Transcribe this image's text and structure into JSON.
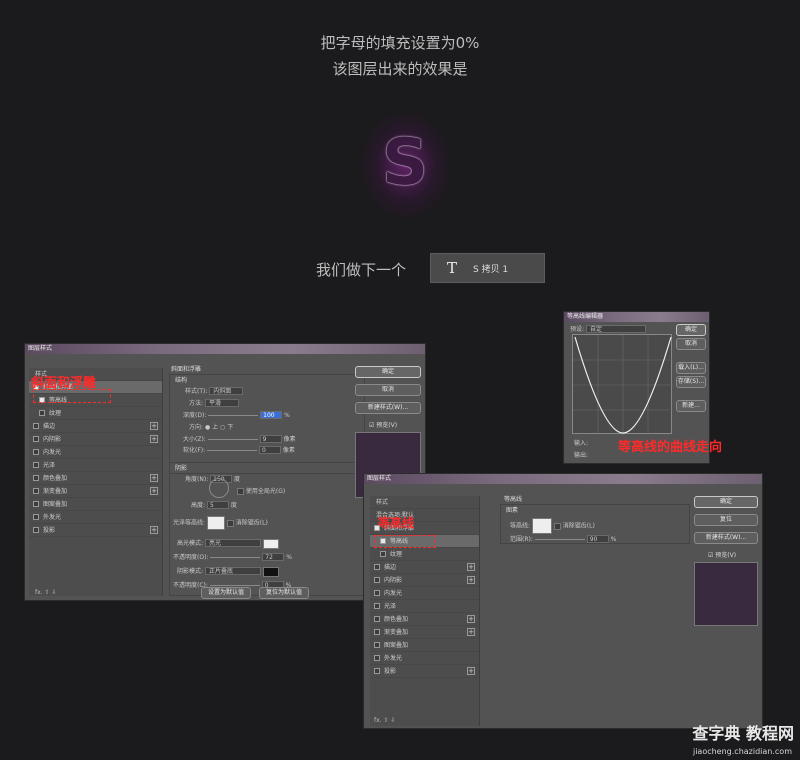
{
  "captions": [
    "把字母的填充设置为0%",
    "该图层出来的效果是"
  ],
  "preview_glyph": "S",
  "next_step": {
    "label": "我们做下一个",
    "layer_icon": "T",
    "layer_name": "S 拷贝 1"
  },
  "dialog1": {
    "title": "图层样式",
    "list": [
      {
        "label": "样式",
        "type": "head"
      },
      {
        "label": "斜面和浮雕",
        "checked": true,
        "selected": true
      },
      {
        "label": "等高线",
        "checked": true,
        "sub": true
      },
      {
        "label": "纹理",
        "checked": false,
        "sub": true
      },
      {
        "label": "描边",
        "plus": true
      },
      {
        "label": "内阴影",
        "plus": true
      },
      {
        "label": "内发光"
      },
      {
        "label": "光泽"
      },
      {
        "label": "颜色叠加",
        "plus": true
      },
      {
        "label": "渐变叠加",
        "plus": true
      },
      {
        "label": "图案叠加"
      },
      {
        "label": "外发光"
      },
      {
        "label": "投影",
        "plus": true
      }
    ],
    "footer": "fx. ⇧ ⇩",
    "section_title": "斜面和浮雕",
    "structure_title": "结构",
    "style_label": "样式(T):",
    "style_value": "内斜面",
    "method_label": "方法:",
    "method_value": "平滑",
    "depth_label": "深度(D):",
    "depth_value": "100",
    "depth_unit": "%",
    "direction_label": "方向:",
    "dir_up": "上",
    "dir_down": "下",
    "size_label": "大小(Z):",
    "size_value": "9",
    "size_unit": "像素",
    "soften_label": "软化(F):",
    "soften_value": "0",
    "soften_unit": "像素",
    "shading_title": "阴影",
    "angle_label": "角度(N):",
    "angle_value": "150",
    "angle_unit": "度",
    "global_light": "使用全局光(G)",
    "altitude_label": "高度:",
    "altitude_value": "5",
    "altitude_unit": "度",
    "gloss_label": "光泽等高线:",
    "antialias": "消除锯齿(L)",
    "highlight_label": "高光模式:",
    "highlight_value": "亮光",
    "opacity1_label": "不透明度(O):",
    "opacity1_value": "72",
    "opacity_unit": "%",
    "shadow_label": "阴影模式:",
    "shadow_value": "正片叠底",
    "opacity2_label": "不透明度(C):",
    "opacity2_value": "0",
    "default_btn": "设置为默认值",
    "reset_btn": "复位为默认值",
    "ok": "确定",
    "cancel": "取消",
    "new_style": "新建样式(W)...",
    "preview": "预览(V)",
    "annotation": "斜面和浮雕"
  },
  "curve_dialog": {
    "title": "等高线编辑器",
    "preset_label": "预设:",
    "preset_value": "自定",
    "mapping": "映射",
    "ok": "确定",
    "cancel": "取消",
    "load": "载入(L)...",
    "save": "存储(S)...",
    "new": "新建...",
    "input": "输入:",
    "output": "输出:",
    "annotation": "等高线的曲线走向"
  },
  "dialog2": {
    "title": "图层样式",
    "list": [
      {
        "label": "样式",
        "type": "head"
      },
      {
        "label": "混合选项:默认",
        "type": "head"
      },
      {
        "label": "斜面和浮雕",
        "checked": true
      },
      {
        "label": "等高线",
        "checked": true,
        "sub": true,
        "selected": true
      },
      {
        "label": "纹理",
        "checked": false,
        "sub": true
      },
      {
        "label": "描边",
        "plus": true
      },
      {
        "label": "内阴影",
        "plus": true
      },
      {
        "label": "内发光"
      },
      {
        "label": "光泽"
      },
      {
        "label": "颜色叠加",
        "plus": true
      },
      {
        "label": "渐变叠加",
        "plus": true
      },
      {
        "label": "图案叠加"
      },
      {
        "label": "外发光"
      },
      {
        "label": "投影",
        "plus": true
      }
    ],
    "footer": "fx. ⇧ ⇩",
    "section_title": "等高线",
    "elements_title": "图素",
    "contour_label": "等高线:",
    "antialias": "消除锯齿(L)",
    "range_label": "范围(R):",
    "range_value": "90",
    "range_unit": "%",
    "ok": "确定",
    "reset": "复位",
    "new_style": "新建样式(W)...",
    "preview": "预览(V)",
    "annotation": "等高线"
  },
  "watermark": {
    "text": "查字典 教程网",
    "url": "jiaocheng.chazidian.com"
  },
  "colors": {
    "background": "#1b1a1c",
    "accent_red": "#ff2a2a",
    "purple_glow": "#8a2a92",
    "highlight_blue": "#3b6fd6"
  }
}
